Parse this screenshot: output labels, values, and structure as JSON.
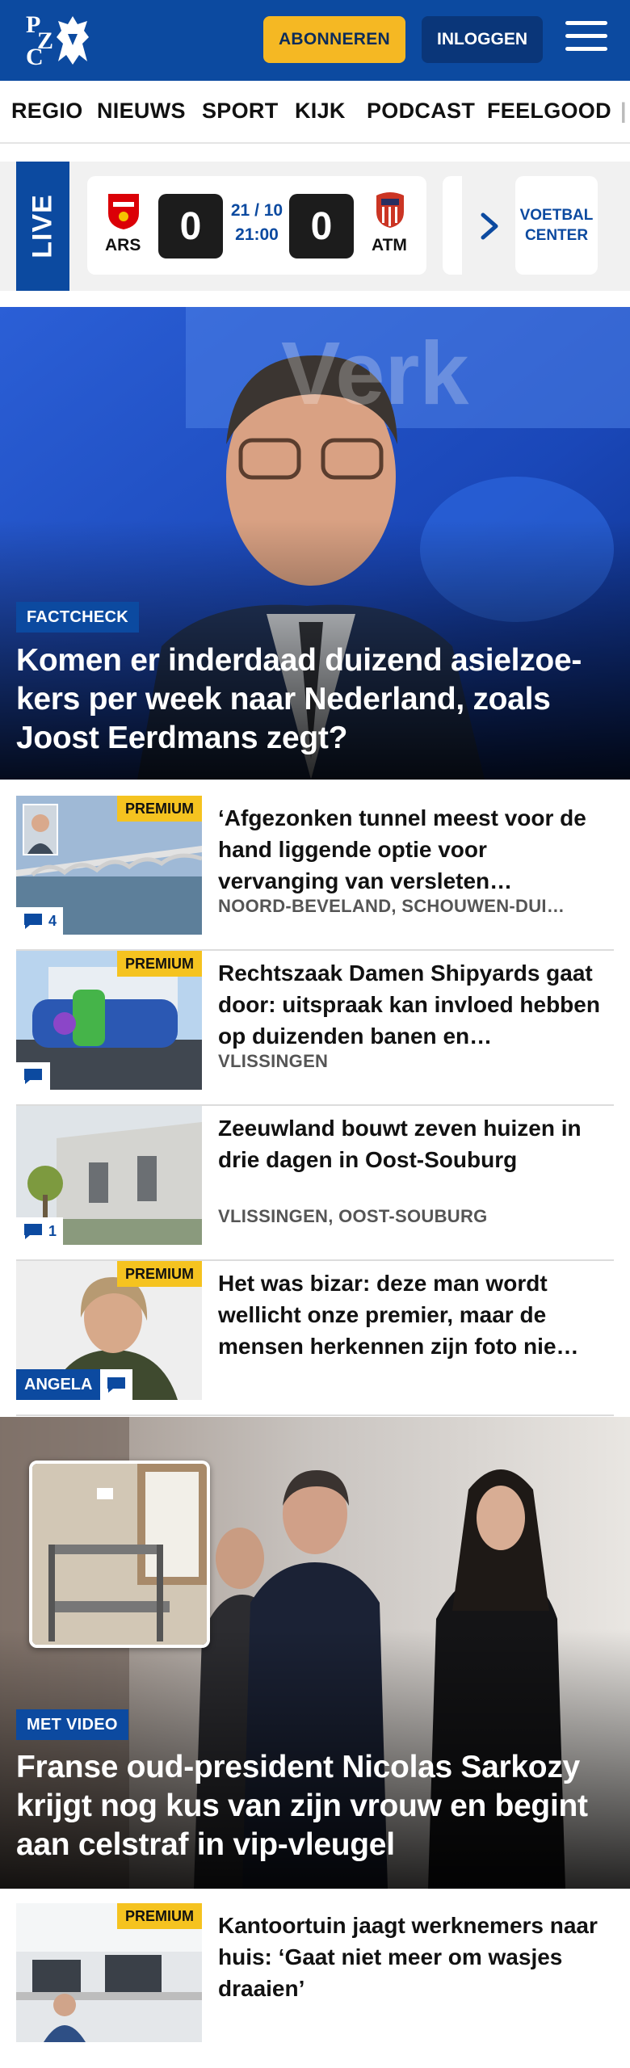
{
  "header": {
    "logo_letters": [
      "P",
      "Z",
      "C"
    ],
    "subscribe_label": "ABONNEREN",
    "login_label": "INLOGGEN",
    "colors": {
      "brand": "#0c4aa0",
      "accent": "#f5b823"
    }
  },
  "nav": {
    "items": [
      "REGIO",
      "NIEUWS",
      "SPORT",
      "KIJK",
      "PODCAST",
      "FEELGOOD"
    ]
  },
  "live": {
    "label": "LIVE",
    "match": {
      "home": "ARS",
      "away": "ATM",
      "home_score": "0",
      "away_score": "0",
      "date": "21 / 10",
      "time": "21:00"
    },
    "center_label_1": "VOETBAL",
    "center_label_2": "CENTER"
  },
  "hero": {
    "label": "FACTCHECK",
    "title": "Komen er inderdaad duizend asielzoe­kers per week naar Nederland, zoals Joost Eerdmans zegt?",
    "backdrop_text": "Verk"
  },
  "articles": [
    {
      "title": "‘Afgezonken tunnel meest voor de hand liggende optie voor vervanging van versleten…",
      "location": "NOORD-BEVELAND, SCHOUWEN-DUI…",
      "premium": "PREMIUM",
      "comments": "4"
    },
    {
      "title": "Rechtszaak Damen Shipyards gaat door: uitspraak kan invloed hebben op duizenden banen en…",
      "location": "VLISSINGEN",
      "premium": "PREMIUM",
      "comments": ""
    },
    {
      "title": "Zeeuwland bouwt zeven huizen in drie dagen in Oost-Souburg",
      "location": "VLISSINGEN, OOST-SOUBURG",
      "premium": "",
      "comments": "1"
    },
    {
      "title": "Het was bizar: deze man wordt wellicht onze premier, maar de mensen herkennen zijn foto nie…",
      "location": "",
      "premium": "PREMIUM",
      "comments": "",
      "author_label": "ANGELA"
    }
  ],
  "hero2": {
    "label": "MET VIDEO",
    "title": "Franse oud-president Nicolas Sarkozy krijgt nog kus van zijn vrouw en begint aan celstraf in vip-vleugel"
  },
  "article_bottom": {
    "title": "Kantoortuin jaagt werknemers naar huis: ‘Gaat niet meer om wasjes draaien’",
    "premium": "PREMIUM"
  }
}
